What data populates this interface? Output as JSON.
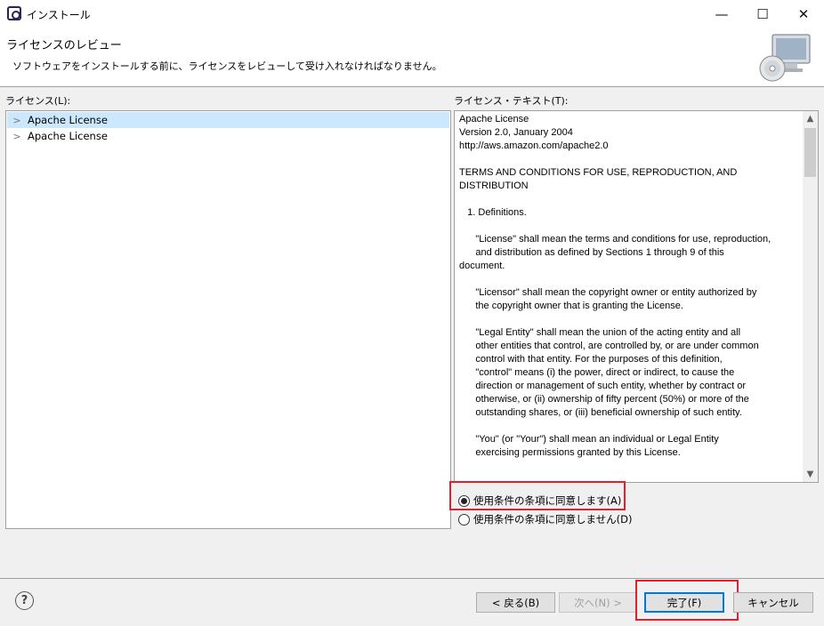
{
  "window": {
    "title": "インストール",
    "minimize": "—",
    "maximize": "☐",
    "close": "✕"
  },
  "header": {
    "title": "ライセンスのレビュー",
    "description": "ソフトウェアをインストールする前に、ライセンスをレビューして受け入れなければなりません。"
  },
  "licenses": {
    "label": "ライセンス(L):",
    "items": [
      {
        "label": "Apache License",
        "selected": true
      },
      {
        "label": "Apache License",
        "selected": false
      }
    ]
  },
  "license_text": {
    "label": "ライセンス・テキスト(T):",
    "content": "Apache License\nVersion 2.0, January 2004\nhttp://aws.amazon.com/apache2.0\n\nTERMS AND CONDITIONS FOR USE, REPRODUCTION, AND\nDISTRIBUTION\n\n   1. Definitions.\n\n      \"License\" shall mean the terms and conditions for use, reproduction,\n      and distribution as defined by Sections 1 through 9 of this\ndocument.\n\n      \"Licensor\" shall mean the copyright owner or entity authorized by\n      the copyright owner that is granting the License.\n\n      \"Legal Entity\" shall mean the union of the acting entity and all\n      other entities that control, are controlled by, or are under common\n      control with that entity. For the purposes of this definition,\n      \"control\" means (i) the power, direct or indirect, to cause the\n      direction or management of such entity, whether by contract or\n      otherwise, or (ii) ownership of fifty percent (50%) or more of the\n      outstanding shares, or (iii) beneficial ownership of such entity.\n\n      \"You\" (or \"Your\") shall mean an individual or Legal Entity\n      exercising permissions granted by this License."
  },
  "agreement": {
    "accept_label": "使用条件の条項に同意します(A)",
    "decline_label": "使用条件の条項に同意しません(D)",
    "selected": "accept"
  },
  "buttons": {
    "back": "< 戻る(B)",
    "next": "次へ(N) >",
    "finish": "完了(F)",
    "cancel": "キャンセル"
  },
  "icons": {
    "help": "?",
    "scroll_up": "▲",
    "scroll_down": "▼",
    "tree_expand": ">"
  },
  "colors": {
    "highlight": "#e0202a",
    "selection": "#cce8ff",
    "default_button_border": "#0078d7"
  }
}
